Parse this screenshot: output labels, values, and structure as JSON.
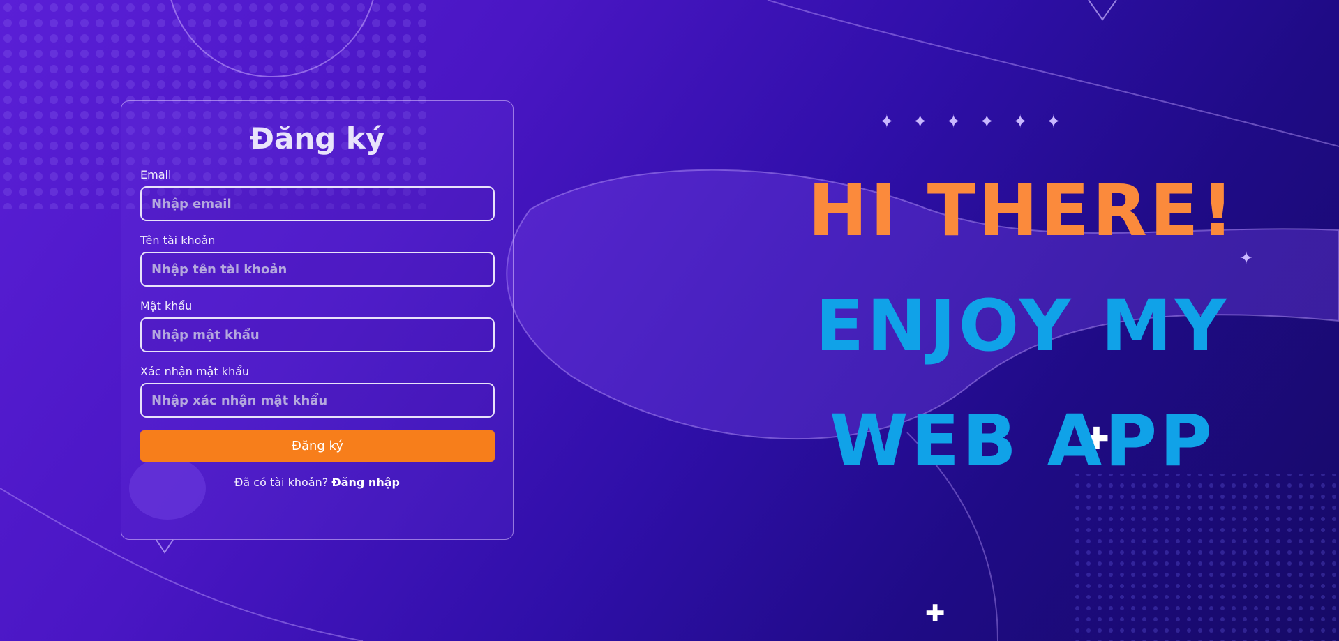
{
  "register_form": {
    "title": "Đăng ký",
    "email_label": "Email",
    "email_placeholder": "Nhập email",
    "username_label": "Tên tài khoản",
    "username_placeholder": "Nhập tên tài khoản",
    "password_label": "Mật khẩu",
    "password_placeholder": "Nhập mật khẩu",
    "confirm_label": "Xác nhận mật khẩu",
    "confirm_placeholder": "Nhập xác nhận mật khẩu",
    "submit_label": "Đăng ký",
    "has_account_text": "Đã có tài khoản?",
    "login_link": "Đăng nhập"
  },
  "hero": {
    "line1": "HI THERE!",
    "line2": "ENJOY MY",
    "line3": "WEB APP"
  },
  "colors": {
    "accent_orange": "#f77e1b",
    "hero_orange": "#fb8a3c",
    "hero_blue": "#10a2e8",
    "background_purple": "#3f12b8"
  },
  "decor": {
    "sparkle_icon": "sparkle-icon",
    "plus_icon": "plus-icon"
  }
}
